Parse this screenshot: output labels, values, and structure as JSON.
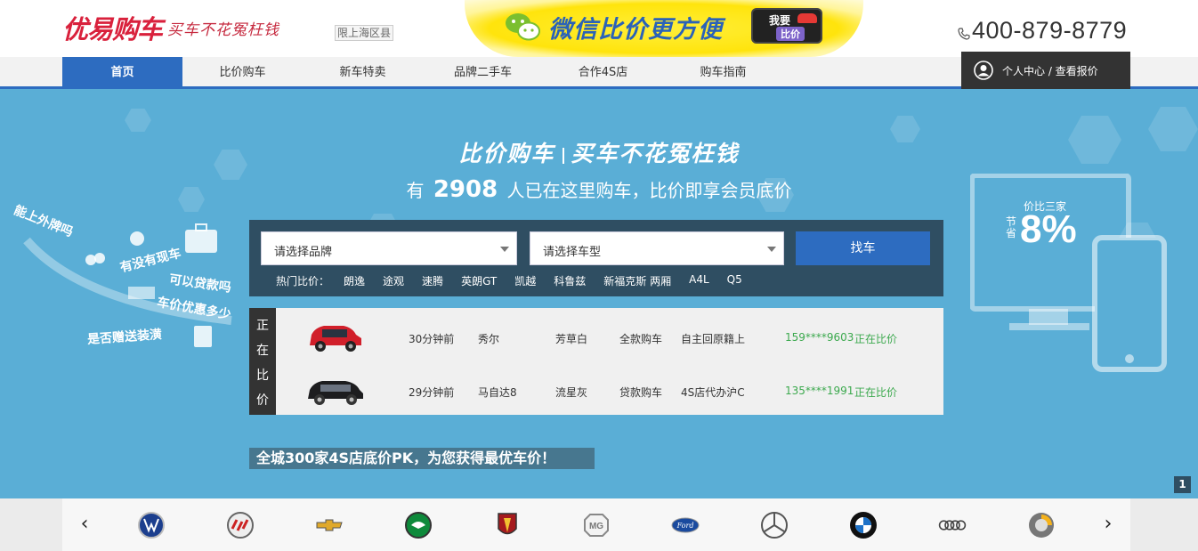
{
  "header": {
    "logo_main": "优易购车",
    "logo_slogan": "买车不花冤枉钱",
    "region_tag": "限上海区县",
    "wechat_banner": {
      "text": "微信比价更方便",
      "button_line1": "我要",
      "button_line2": "比价"
    },
    "phone": "400-879-8779"
  },
  "nav": {
    "items": [
      {
        "label": "首页",
        "active": true
      },
      {
        "label": "比价购车",
        "active": false
      },
      {
        "label": "新车特卖",
        "active": false
      },
      {
        "label": "品牌二手车",
        "active": false
      },
      {
        "label": "合作4S店",
        "active": false
      },
      {
        "label": "购车指南",
        "active": false
      }
    ],
    "user_center": "个人中心 / 查看报价"
  },
  "hero": {
    "title_left": "比价购车",
    "title_right": "买车不花冤枉钱",
    "sub_prefix": "有",
    "count": "2908",
    "sub_suffix": "人已在这里购车，比价即享会员底价",
    "left_tags": [
      "能上外牌吗",
      "有没有现车",
      "可以贷款吗",
      "车价优惠多少",
      "是否赠送装潢"
    ],
    "monitor": {
      "caption": "价比三家",
      "save_label": "节省",
      "percent": "8%"
    }
  },
  "search": {
    "brand_placeholder": "请选择品牌",
    "model_placeholder": "请选择车型",
    "find_button": "找车",
    "hot_label": "热门比价：",
    "hot_items": [
      "朗逸",
      "途观",
      "速腾",
      "英朗GT",
      "凯越",
      "科鲁兹",
      "新福克斯 两厢",
      "A4L",
      "Q5"
    ]
  },
  "ticker": {
    "tag_chars": [
      "正",
      "在",
      "比",
      "价"
    ],
    "rows": [
      {
        "time": "30分钟前",
        "model": "秀尔",
        "color": "芳草白",
        "pay": "全款购车",
        "note": "自主回原籍上",
        "phone": "159****9603",
        "status": "正在比价"
      },
      {
        "time": "29分钟前",
        "model": "马自达8",
        "color": "流星灰",
        "pay": "贷款购车",
        "note": "4S店代办沪C",
        "phone": "135****1991",
        "status": "正在比价"
      }
    ]
  },
  "slogan": "全城300家4S店底价PK，为您获得最优车价！",
  "slide_index": "1",
  "brand_strip": {
    "prev": "‹",
    "next": "›",
    "brands": [
      "volkswagen-logo",
      "buick-logo",
      "chevrolet-logo",
      "skoda-logo",
      "roewe-logo",
      "mg-logo",
      "ford-logo",
      "mercedes-logo",
      "bmw-logo",
      "audi-logo",
      "smart-logo"
    ]
  },
  "colors": {
    "brand_red": "#d9213c",
    "nav_blue": "#2d6cc0",
    "hero_bg": "#5aaed6",
    "search_bg": "#2f4e62",
    "status_green": "#3ca94e"
  }
}
